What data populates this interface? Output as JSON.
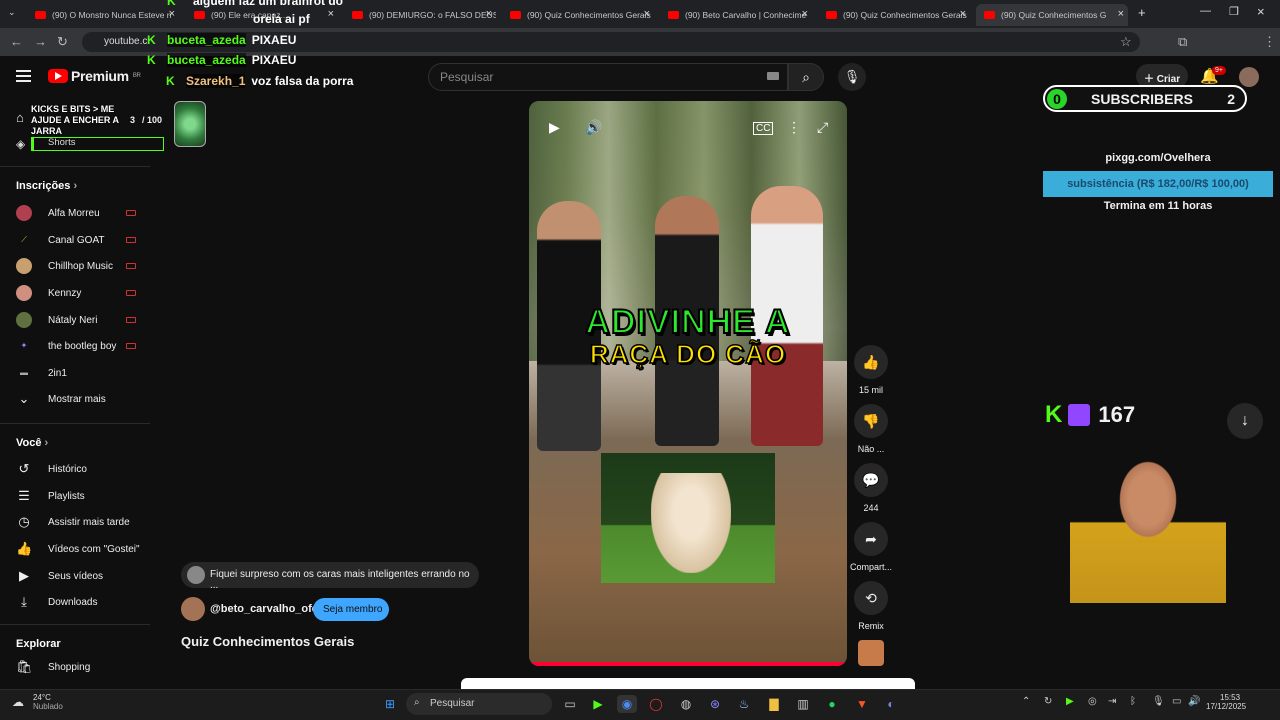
{
  "browser": {
    "tabs": [
      {
        "label": "(90) O Monstro Nunca Esteve n"
      },
      {
        "label": "(90) Ele era capaz..."
      },
      {
        "label": "(90) DEMIURGO: o FALSO DEUS"
      },
      {
        "label": "(90) Quiz Conhecimentos Gerais"
      },
      {
        "label": "(90) Beto Carvalho | Conhecime"
      },
      {
        "label": "(90) Quiz Conhecimentos Gerais"
      },
      {
        "label": "(90) Quiz Conhecimentos G"
      }
    ],
    "url": "youtube.c"
  },
  "header": {
    "logo": "Premium",
    "logo_region": "BR",
    "search_placeholder": "Pesquisar",
    "create_label": "Criar",
    "notifications": "9+"
  },
  "sidebar": {
    "overlay_title": "KICKS E BITS > ME AJUDE A ENCHER A JARRA",
    "jar_count": "3",
    "jar_total": "/ 100",
    "shorts": "Shorts",
    "subscriptions_title": "Inscrições",
    "channels": [
      {
        "name": "Alfa Morreu"
      },
      {
        "name": "Canal GOAT"
      },
      {
        "name": "Chillhop Music"
      },
      {
        "name": "Kennzy"
      },
      {
        "name": "Nátaly Neri"
      },
      {
        "name": "the bootleg boy"
      },
      {
        "name": "2in1"
      }
    ],
    "show_more": "Mostrar mais",
    "you_title": "Você",
    "you_items": [
      {
        "label": "Histórico"
      },
      {
        "label": "Playlists"
      },
      {
        "label": "Assistir mais tarde"
      },
      {
        "label": "Vídeos com \"Gostei\""
      },
      {
        "label": "Seus vídeos"
      },
      {
        "label": "Downloads"
      }
    ],
    "explore_title": "Explorar",
    "explore_items": [
      {
        "label": "Shopping"
      }
    ]
  },
  "chat": [
    {
      "user": "",
      "message": "alguem faz um brainrot do"
    },
    {
      "user": "",
      "message": "oreia ai pf"
    },
    {
      "user": "buceta_azeda",
      "message": "PIXAEU"
    },
    {
      "user": "buceta_azeda",
      "message": "PIXAEU"
    },
    {
      "user": "Szarekh_1",
      "message": "voz falsa da porra"
    }
  ],
  "short": {
    "overlay_line1": "ADIVINHE A",
    "overlay_line2": "RAÇA DO CÃO",
    "likes": "15 mil",
    "dislike_label": "Não ...",
    "comments": "244",
    "share_label": "Compart...",
    "remix_label": "Remix",
    "reference_text": "Fiquei surpreso com os caras mais inteligentes errando no ...",
    "channel": "@beto_carvalho_ofc",
    "join_label": "Seja membro",
    "title": "Quiz Conhecimentos Gerais",
    "progress": 1.0
  },
  "stream_overlay": {
    "subs_left": "0",
    "subs_label": "SUBSCRIBERS",
    "subs_right": "2",
    "pix_url": "pixgg.com/Ovelhera",
    "goal_text": "subsistência (R$ 182,00/R$ 100,00)",
    "ends_text": "Termina em 11 horas",
    "viewers": "167"
  },
  "taskbar": {
    "temperature": "24°C",
    "weather": "Nublado",
    "search": "Pesquisar",
    "time": "15:53",
    "date": "17/12/2025"
  },
  "colors": {
    "accent": "#ff0000",
    "kick": "#53fc18",
    "member": "#3ea6ff"
  }
}
